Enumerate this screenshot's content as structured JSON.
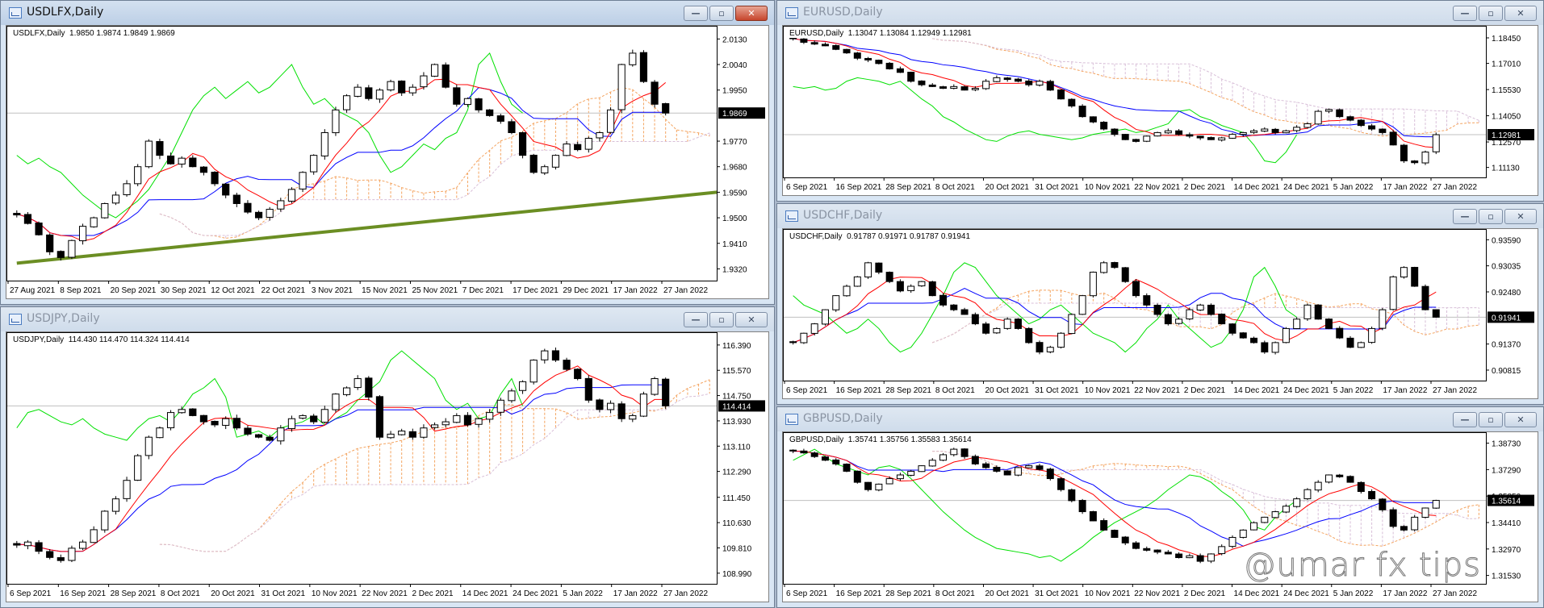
{
  "windows": [
    {
      "id": "usdlfx",
      "title": "USDLFX,Daily",
      "ohlc": "USDLFX,Daily  1.9850 1.9874 1.9849 1.9869",
      "active": true,
      "last": 1.9869,
      "last_label": "1.9869",
      "ylim": [
        1.929,
        2.0165
      ],
      "ticks": [
        "2.0130",
        "2.0040",
        "1.9950",
        "1.9770",
        "1.9680",
        "1.9590",
        "1.9500",
        "1.9410",
        "1.9320"
      ],
      "dates": [
        "27 Aug 2021",
        "8 Sep 2021",
        "20 Sep 2021",
        "30 Sep 2021",
        "12 Oct 2021",
        "22 Oct 2021",
        "3 Nov 2021",
        "15 Nov 2021",
        "25 Nov 2021",
        "7 Dec 2021",
        "17 Dec 2021",
        "29 Dec 2021",
        "17 Jan 2022",
        "27 Jan 2022"
      ],
      "trendline": {
        "from": 1.934,
        "to": 1.959,
        "color": "#6b8e23"
      },
      "closes": [
        1.951,
        1.948,
        1.944,
        1.938,
        1.936,
        1.942,
        1.947,
        1.95,
        1.955,
        1.958,
        1.962,
        1.968,
        1.977,
        1.972,
        1.969,
        1.971,
        1.968,
        1.966,
        1.962,
        1.958,
        1.955,
        1.952,
        1.95,
        1.953,
        1.956,
        1.96,
        1.966,
        1.972,
        1.98,
        1.988,
        1.993,
        1.996,
        1.992,
        1.995,
        1.998,
        1.994,
        1.996,
        2.0,
        2.004,
        1.996,
        1.99,
        1.992,
        1.988,
        1.986,
        1.984,
        1.98,
        1.972,
        1.966,
        1.968,
        1.972,
        1.976,
        1.974,
        1.978,
        1.98,
        1.988,
        2.004,
        2.008,
        1.998,
        1.99,
        1.9869
      ]
    },
    {
      "id": "usdjpy",
      "title": "USDJPY,Daily",
      "ohlc": "USDJPY,Daily  114.430 114.470 114.324 114.414",
      "active": false,
      "last": 114.414,
      "last_label": "114.414",
      "ylim": [
        108.75,
        116.7
      ],
      "ticks": [
        "116.390",
        "115.570",
        "114.750",
        "113.930",
        "113.110",
        "112.290",
        "111.450",
        "110.630",
        "109.810",
        "108.990"
      ],
      "dates": [
        "6 Sep 2021",
        "16 Sep 2021",
        "28 Sep 2021",
        "8 Oct 2021",
        "20 Oct 2021",
        "31 Oct 2021",
        "10 Nov 2021",
        "22 Nov 2021",
        "2 Dec 2021",
        "14 Dec 2021",
        "24 Dec 2021",
        "5 Jan 2022",
        "17 Jan 2022",
        "27 Jan 2022"
      ],
      "closes": [
        109.9,
        110.0,
        109.7,
        109.5,
        109.4,
        109.8,
        110.0,
        110.4,
        111.0,
        111.4,
        112.0,
        112.8,
        113.4,
        113.7,
        114.2,
        114.3,
        114.1,
        113.9,
        113.8,
        114.0,
        113.7,
        113.5,
        113.4,
        113.3,
        113.7,
        114.0,
        114.1,
        113.9,
        114.3,
        114.8,
        115.0,
        115.3,
        114.7,
        113.4,
        113.5,
        113.6,
        113.4,
        113.7,
        113.8,
        113.9,
        114.1,
        113.8,
        114.0,
        114.2,
        114.6,
        114.9,
        115.2,
        115.9,
        116.2,
        115.9,
        115.6,
        115.3,
        114.6,
        114.3,
        114.5,
        114.0,
        114.1,
        114.8,
        115.3,
        114.414
      ]
    },
    {
      "id": "eurusd",
      "title": "EURUSD,Daily",
      "ohlc": "EURUSD,Daily  1.13047 1.13084 1.12949 1.12981",
      "active": false,
      "last": 1.12981,
      "last_label": "1.12981",
      "ylim": [
        1.1075,
        1.1895
      ],
      "ticks": [
        "1.18450",
        "1.17010",
        "1.15530",
        "1.14050",
        "1.12570",
        "1.11130"
      ],
      "dates": [
        "6 Sep 2021",
        "16 Sep 2021",
        "28 Sep 2021",
        "8 Oct 2021",
        "20 Oct 2021",
        "31 Oct 2021",
        "10 Nov 2021",
        "22 Nov 2021",
        "2 Dec 2021",
        "14 Dec 2021",
        "24 Dec 2021",
        "5 Jan 2022",
        "17 Jan 2022",
        "27 Jan 2022"
      ],
      "closes": [
        1.184,
        1.182,
        1.181,
        1.18,
        1.178,
        1.176,
        1.173,
        1.172,
        1.17,
        1.167,
        1.165,
        1.16,
        1.158,
        1.157,
        1.156,
        1.157,
        1.155,
        1.156,
        1.16,
        1.162,
        1.161,
        1.16,
        1.158,
        1.16,
        1.155,
        1.15,
        1.146,
        1.14,
        1.137,
        1.133,
        1.13,
        1.127,
        1.126,
        1.129,
        1.131,
        1.132,
        1.13,
        1.129,
        1.128,
        1.127,
        1.128,
        1.13,
        1.131,
        1.132,
        1.133,
        1.131,
        1.132,
        1.134,
        1.136,
        1.143,
        1.144,
        1.14,
        1.138,
        1.135,
        1.133,
        1.131,
        1.124,
        1.115,
        1.114,
        1.12,
        1.12981
      ]
    },
    {
      "id": "usdchf",
      "title": "USDCHF,Daily",
      "ohlc": "USDCHF,Daily  0.91787 0.91971 0.91787 0.91941",
      "active": false,
      "last": 0.91941,
      "last_label": "0.91941",
      "ylim": [
        0.9066,
        0.9375
      ],
      "ticks": [
        "0.93590",
        "0.93035",
        "0.92480",
        "0.91370",
        "0.90815"
      ],
      "dates": [
        "6 Sep 2021",
        "16 Sep 2021",
        "28 Sep 2021",
        "8 Oct 2021",
        "20 Oct 2021",
        "31 Oct 2021",
        "10 Nov 2021",
        "22 Nov 2021",
        "2 Dec 2021",
        "14 Dec 2021",
        "24 Dec 2021",
        "5 Jan 2022",
        "17 Jan 2022",
        "27 Jan 2022"
      ],
      "closes": [
        0.914,
        0.916,
        0.918,
        0.921,
        0.924,
        0.926,
        0.928,
        0.931,
        0.929,
        0.927,
        0.925,
        0.926,
        0.927,
        0.924,
        0.922,
        0.921,
        0.92,
        0.918,
        0.916,
        0.917,
        0.919,
        0.917,
        0.914,
        0.912,
        0.913,
        0.916,
        0.92,
        0.924,
        0.929,
        0.931,
        0.93,
        0.927,
        0.924,
        0.922,
        0.92,
        0.918,
        0.919,
        0.921,
        0.922,
        0.92,
        0.918,
        0.916,
        0.915,
        0.914,
        0.912,
        0.914,
        0.917,
        0.919,
        0.922,
        0.919,
        0.917,
        0.915,
        0.913,
        0.914,
        0.917,
        0.921,
        0.928,
        0.93,
        0.926,
        0.921,
        0.91941
      ]
    },
    {
      "id": "gbpusd",
      "title": "GBPUSD,Daily",
      "ohlc": "GBPUSD,Daily  1.35741 1.35756 1.35583 1.35614",
      "active": false,
      "last": 1.35614,
      "last_label": "1.35614",
      "ylim": [
        1.3125,
        1.3915
      ],
      "ticks": [
        "1.38730",
        "1.37290",
        "1.35850",
        "1.34410",
        "1.32970",
        "1.31530"
      ],
      "dates": [
        "6 Sep 2021",
        "16 Sep 2021",
        "28 Sep 2021",
        "8 Oct 2021",
        "20 Oct 2021",
        "31 Oct 2021",
        "10 Nov 2021",
        "22 Nov 2021",
        "2 Dec 2021",
        "14 Dec 2021",
        "24 Dec 2021",
        "5 Jan 2022",
        "17 Jan 2022",
        "27 Jan 2022"
      ],
      "watermark": "@umar fx tips",
      "closes": [
        1.383,
        1.382,
        1.38,
        1.378,
        1.376,
        1.372,
        1.366,
        1.362,
        1.365,
        1.368,
        1.37,
        1.372,
        1.375,
        1.378,
        1.381,
        1.384,
        1.38,
        1.376,
        1.374,
        1.372,
        1.37,
        1.374,
        1.375,
        1.373,
        1.368,
        1.362,
        1.356,
        1.35,
        1.345,
        1.34,
        1.336,
        1.333,
        1.33,
        1.329,
        1.328,
        1.327,
        1.325,
        1.326,
        1.323,
        1.327,
        1.331,
        1.336,
        1.34,
        1.344,
        1.347,
        1.35,
        1.353,
        1.357,
        1.362,
        1.366,
        1.37,
        1.369,
        1.366,
        1.361,
        1.357,
        1.351,
        1.342,
        1.34,
        1.347,
        1.352,
        1.35614
      ]
    }
  ],
  "buttons": {
    "minimize": "—",
    "restore": "▫",
    "close": "✕"
  },
  "colors": {
    "tenkan": "#ff0000",
    "kijun": "#0000ff",
    "chikou": "#00e000",
    "span_a": "#f4a460",
    "span_b": "#d8bfd8",
    "last_line": "#c0c0c0"
  }
}
